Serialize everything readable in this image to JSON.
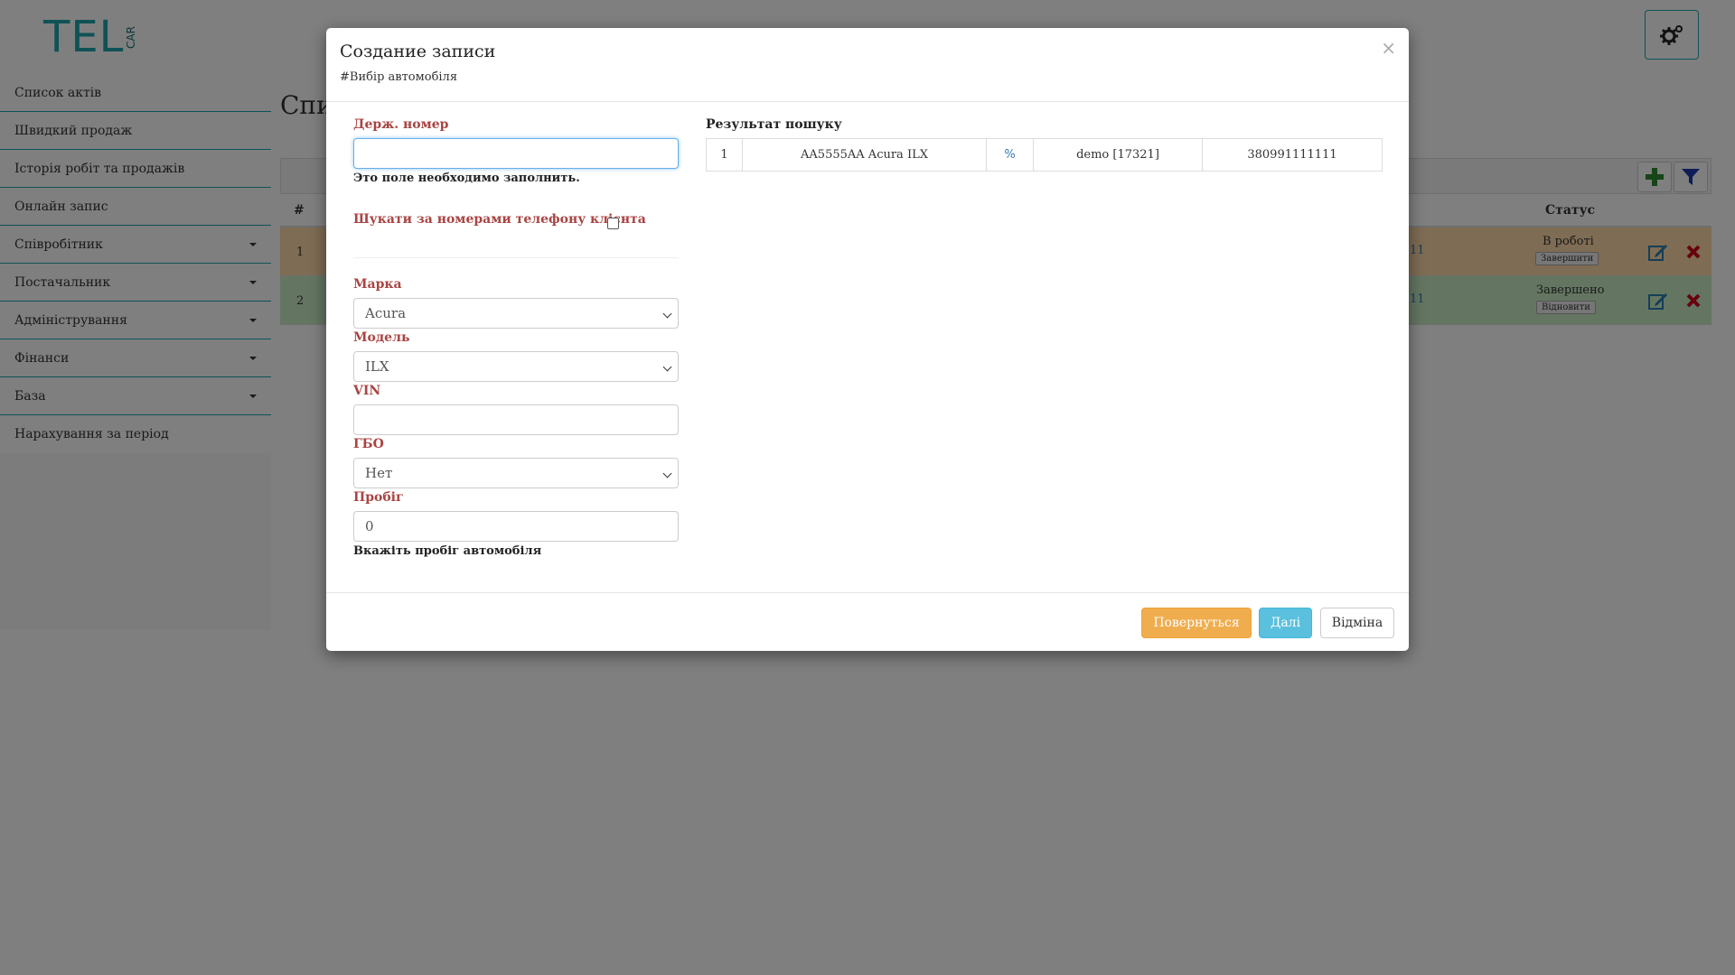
{
  "app": {
    "logo_text": "TEL",
    "logo_sub": "CAR"
  },
  "sidebar": {
    "items": [
      {
        "label": "Список актів"
      },
      {
        "label": "Швидкий продаж"
      },
      {
        "label": "Історія робіт та продажів"
      },
      {
        "label": "Онлайн запис"
      },
      {
        "label": "Співробітник"
      },
      {
        "label": "Постачальник"
      },
      {
        "label": "Адміністрування"
      },
      {
        "label": "Фінанси"
      },
      {
        "label": "База"
      },
      {
        "label": "Нарахування за період"
      }
    ]
  },
  "background": {
    "page_title": "Спи",
    "table": {
      "col_num": "#",
      "col_status": "Статус",
      "rows": [
        {
          "num": "1",
          "tail": "11",
          "status": "В роботі",
          "action": "Завершити"
        },
        {
          "num": "2",
          "tail": "11",
          "status": "Завершено",
          "action": "Відновити"
        }
      ]
    }
  },
  "modal": {
    "title": "Создание записи",
    "subtitle": "#Вибір автомобіля",
    "close": "×",
    "plate": {
      "label": "Держ. номер",
      "value": "",
      "error": "Это поле необходимо заполнить."
    },
    "search_by_phone_label": "Шукати за номерами телефону клієнта",
    "brand": {
      "label": "Марка",
      "value": "Acura"
    },
    "model": {
      "label": "Модель",
      "value": "ILX"
    },
    "vin": {
      "label": "VIN",
      "value": ""
    },
    "gbo": {
      "label": "ГБО",
      "value": "Нет"
    },
    "mileage": {
      "label": "Пробіг",
      "value": "0",
      "help": "Вкажіть пробіг автомобіля"
    },
    "results": {
      "title": "Результат пошуку",
      "rows": [
        {
          "num": "1",
          "car": "AA5555AA Acura ILX",
          "link": "%",
          "owner": "demo [17321]",
          "phone": "380991111111"
        }
      ]
    },
    "buttons": {
      "back": "Повернуться",
      "next": "Далі",
      "cancel": "Відміна"
    }
  },
  "colors": {
    "accent": "#1fa5ad",
    "label_red": "#a94442",
    "warning": "#f0ad4e",
    "info": "#5bc0de",
    "row_in_progress": "#fcd8a8",
    "row_done": "#c9ecc4"
  }
}
